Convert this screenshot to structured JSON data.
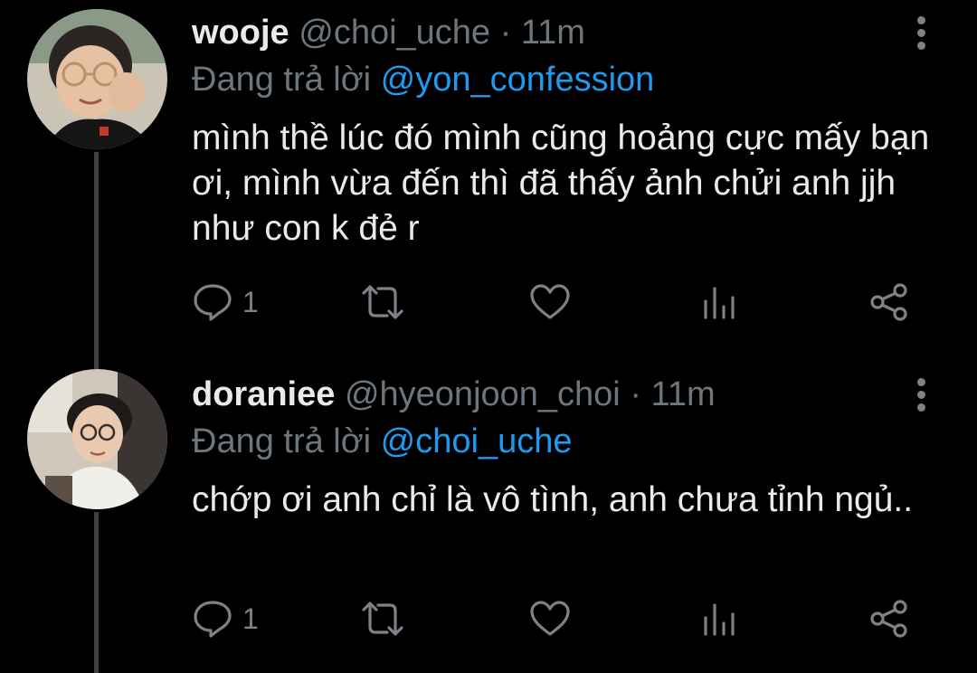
{
  "colors": {
    "background": "#000000",
    "text": "#e8eaeb",
    "muted": "#6e767d",
    "mention": "#1d9bf0",
    "thread_line": "#3d4145"
  },
  "tweets": [
    {
      "name": "wooje",
      "handle": "@choi_uche",
      "separator": "·",
      "time": "11m",
      "reply_prefix": "Đang trả lời",
      "reply_mention": "@yon_confession",
      "text": "mình thề lúc đó mình cũng hoảng cực mấy bạn ơi, mình vừa đến thì đã thấy ảnh chửi anh jjh như con k đẻ r",
      "reply_count": "1",
      "avatar_icon": "profile-photo-wooje"
    },
    {
      "name": "doraniee",
      "handle": "@hyeonjoon_choi",
      "separator": "·",
      "time": "11m",
      "reply_prefix": "Đang trả lời",
      "reply_mention": "@choi_uche",
      "text": "chớp ơi anh chỉ là vô tình, anh chưa tỉnh ngủ..",
      "reply_count": "1",
      "avatar_icon": "profile-photo-doraniee"
    }
  ],
  "icons": {
    "reply": "reply-icon",
    "retweet": "retweet-icon",
    "like": "heart-icon",
    "analytics": "analytics-icon",
    "share": "share-icon",
    "more": "more-vertical-icon"
  }
}
